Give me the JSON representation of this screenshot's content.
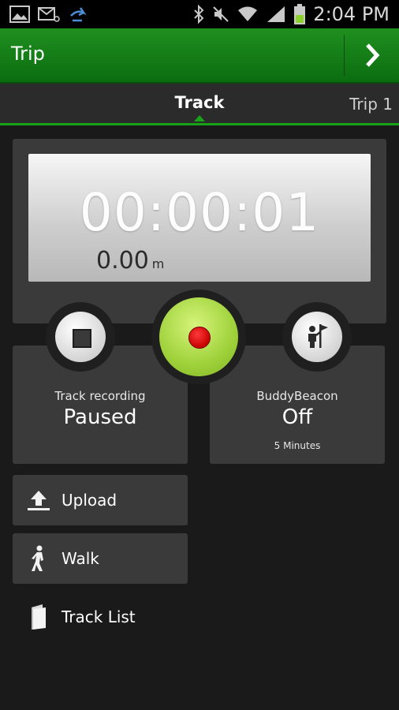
{
  "status_bar": {
    "time": "2:04 PM",
    "icons": [
      "image-icon",
      "email-icon",
      "share-icon",
      "bluetooth-icon",
      "mute-icon",
      "wifi-icon",
      "signal-icon",
      "battery-icon"
    ]
  },
  "action_bar": {
    "title": "Trip",
    "next_icon": "chevron-right-icon"
  },
  "tabs": {
    "active": "Track",
    "next": "Trip 1"
  },
  "timer": {
    "elapsed": "00:00:01",
    "distance": "0.00",
    "distance_unit": "m"
  },
  "track_recording": {
    "label": "Track recording",
    "value": "Paused"
  },
  "buddy_beacon": {
    "label": "BuddyBeacon",
    "value": "Off",
    "interval": "5 Minutes"
  },
  "actions": {
    "upload": "Upload",
    "walk": "Walk",
    "track_list": "Track List"
  },
  "colors": {
    "accent_green": "#17a217",
    "record_green": "#9ed13a",
    "record_red": "#c80000"
  }
}
